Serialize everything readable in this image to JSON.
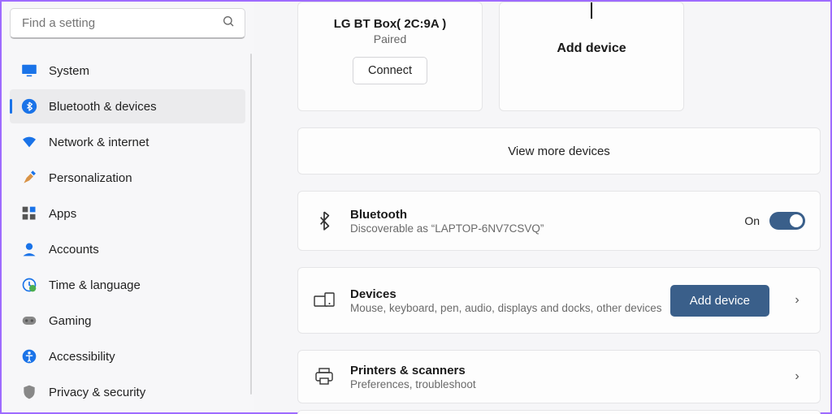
{
  "search": {
    "placeholder": "Find a setting"
  },
  "sidebar": {
    "items": [
      {
        "label": "System"
      },
      {
        "label": "Bluetooth & devices"
      },
      {
        "label": "Network & internet"
      },
      {
        "label": "Personalization"
      },
      {
        "label": "Apps"
      },
      {
        "label": "Accounts"
      },
      {
        "label": "Time & language"
      },
      {
        "label": "Gaming"
      },
      {
        "label": "Accessibility"
      },
      {
        "label": "Privacy & security"
      }
    ],
    "active_index": 1
  },
  "main": {
    "device_card": {
      "title": "LG BT Box( 2C:9A )",
      "status": "Paired",
      "action": "Connect"
    },
    "add_device_card": {
      "label": "Add device"
    },
    "view_more": "View more devices",
    "bluetooth_row": {
      "title": "Bluetooth",
      "sub": "Discoverable as “LAPTOP-6NV7CSVQ”",
      "toggle_label": "On",
      "toggle_on": true
    },
    "devices_row": {
      "title": "Devices",
      "sub": "Mouse, keyboard, pen, audio, displays and docks, other devices",
      "action": "Add device"
    },
    "printers_row": {
      "title": "Printers & scanners",
      "sub": "Preferences, troubleshoot"
    }
  },
  "colors": {
    "accent": "#3a5f8a",
    "annotation": "#8e24e0"
  }
}
